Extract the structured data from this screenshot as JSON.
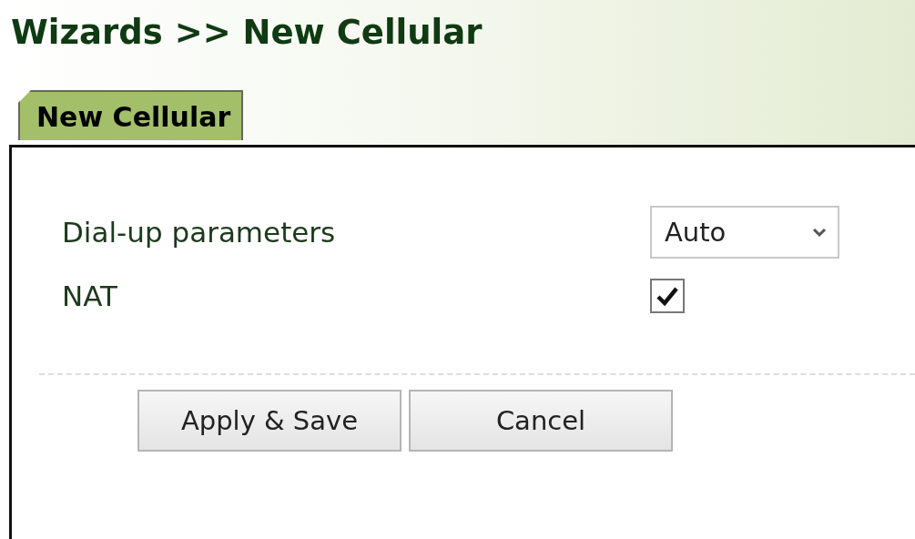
{
  "page_title": "Wizards >> New Cellular",
  "tabs": [
    {
      "label": "New Cellular",
      "selected": true
    }
  ],
  "fields": [
    {
      "kind": "select",
      "label": "Dial-up parameters",
      "value": "Auto"
    },
    {
      "kind": "checkbox",
      "label": "NAT",
      "checked": true
    }
  ],
  "buttons": [
    "Apply & Save",
    "Cancel"
  ]
}
